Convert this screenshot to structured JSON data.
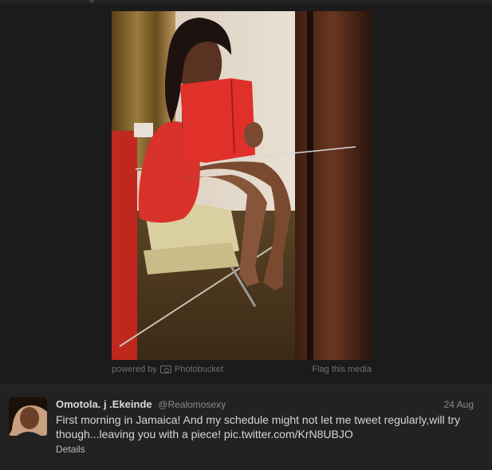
{
  "media": {
    "powered_by_label": "powered by",
    "provider": "Photobucket",
    "flag_label": "Flag this media"
  },
  "tweet": {
    "display_name": "Omotola. j .Ekeinde",
    "handle": "@Realomosexy",
    "date": "24 Aug",
    "text": "First morning in Jamaica! And my schedule might not let me tweet regularly,will try though...leaving you with a piece! pic.twitter.com/KrN8UBJO",
    "details_label": "Details"
  },
  "colors": {
    "background": "#1b1b1b",
    "panel": "#222222",
    "name": "#d8d8d8",
    "muted": "#8a8a8a"
  },
  "icons": {
    "photobucket": "camera-icon"
  }
}
